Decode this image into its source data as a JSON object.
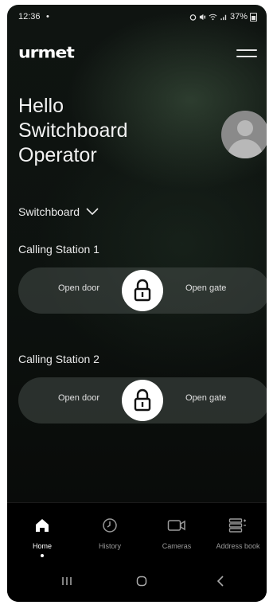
{
  "status_bar": {
    "time": "12:36",
    "dot": "•",
    "battery": "37%"
  },
  "header": {
    "logo": "urmet"
  },
  "greeting": {
    "line1": "Hello",
    "line2": "Switchboard",
    "line3": "Operator"
  },
  "selector": {
    "label": "Switchboard"
  },
  "stations": [
    {
      "title": "Calling Station 1",
      "open_door": "Open door",
      "open_gate": "Open gate"
    },
    {
      "title": "Calling Station 2",
      "open_door": "Open door",
      "open_gate": "Open gate"
    }
  ],
  "nav": {
    "items": [
      {
        "label": "Home",
        "icon": "home-icon",
        "active": true
      },
      {
        "label": "History",
        "icon": "clock-icon",
        "active": false
      },
      {
        "label": "Cameras",
        "icon": "camera-icon",
        "active": false
      },
      {
        "label": "Address book",
        "icon": "address-book-icon",
        "active": false
      }
    ]
  },
  "colors": {
    "background": "#0d120f",
    "accent": "#ffffff",
    "pill": "#464c48"
  }
}
